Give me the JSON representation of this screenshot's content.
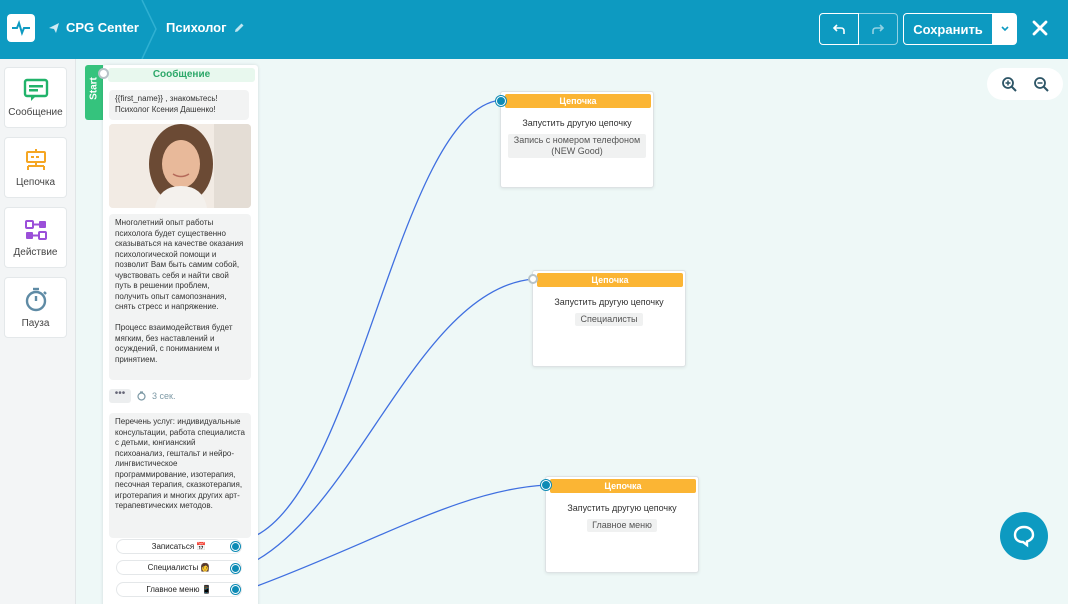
{
  "header": {
    "project": "CPG Center",
    "flow_name": "Психолог",
    "save_label": "Сохранить"
  },
  "sidebar": {
    "items": [
      {
        "label": "Сообщение",
        "icon": "message-icon"
      },
      {
        "label": "Цепочка",
        "icon": "chain-icon"
      },
      {
        "label": "Действие",
        "icon": "action-icon"
      },
      {
        "label": "Пауза",
        "icon": "pause-icon"
      }
    ]
  },
  "start_block": {
    "tab_label": "Start",
    "header": "Сообщение",
    "greeting": "{{first_name}} , знакомьтесь! Психолог Ксения Дашенко!",
    "text_1": "Многолетний опыт работы психолога будет существенно сказываться на качестве оказания  психологической помощи и позволит Вам быть самим собой, чувствовать себя и найти свой путь в решении проблем, получить опыт самопознания, снять стресс и напряжение.\n\nПроцесс взаимодействия будет мягким, без наставлений и осуждений, с пониманием и принятием.",
    "delay": "3 сек.",
    "text_2": "Перечень услуг: индивидуальные консультации, работа специалиста с детьми, юнгианский психоанализ, гештальт и нейро-лингвистическое программирование, изотерапия, песочная терапия, сказкотерапия, игротерапия и многих других арт-терапевтических методов.",
    "buttons": [
      "Записаться 📅",
      "Специалисты 👩",
      "Главное меню 📱"
    ]
  },
  "nodes": [
    {
      "header": "Цепочка",
      "title": "Запустить другую цепочку",
      "tag": "Запись с номером телефоном (NEW Good)"
    },
    {
      "header": "Цепочка",
      "title": "Запустить другую цепочку",
      "tag": "Специалисты"
    },
    {
      "header": "Цепочка",
      "title": "Запустить другую цепочку",
      "tag": "Главное меню"
    }
  ],
  "colors": {
    "header_bg": "#0d9ac1",
    "start_green": "#35c37d",
    "chain_orange": "#fbb534",
    "link_blue": "#3f6fe0"
  }
}
